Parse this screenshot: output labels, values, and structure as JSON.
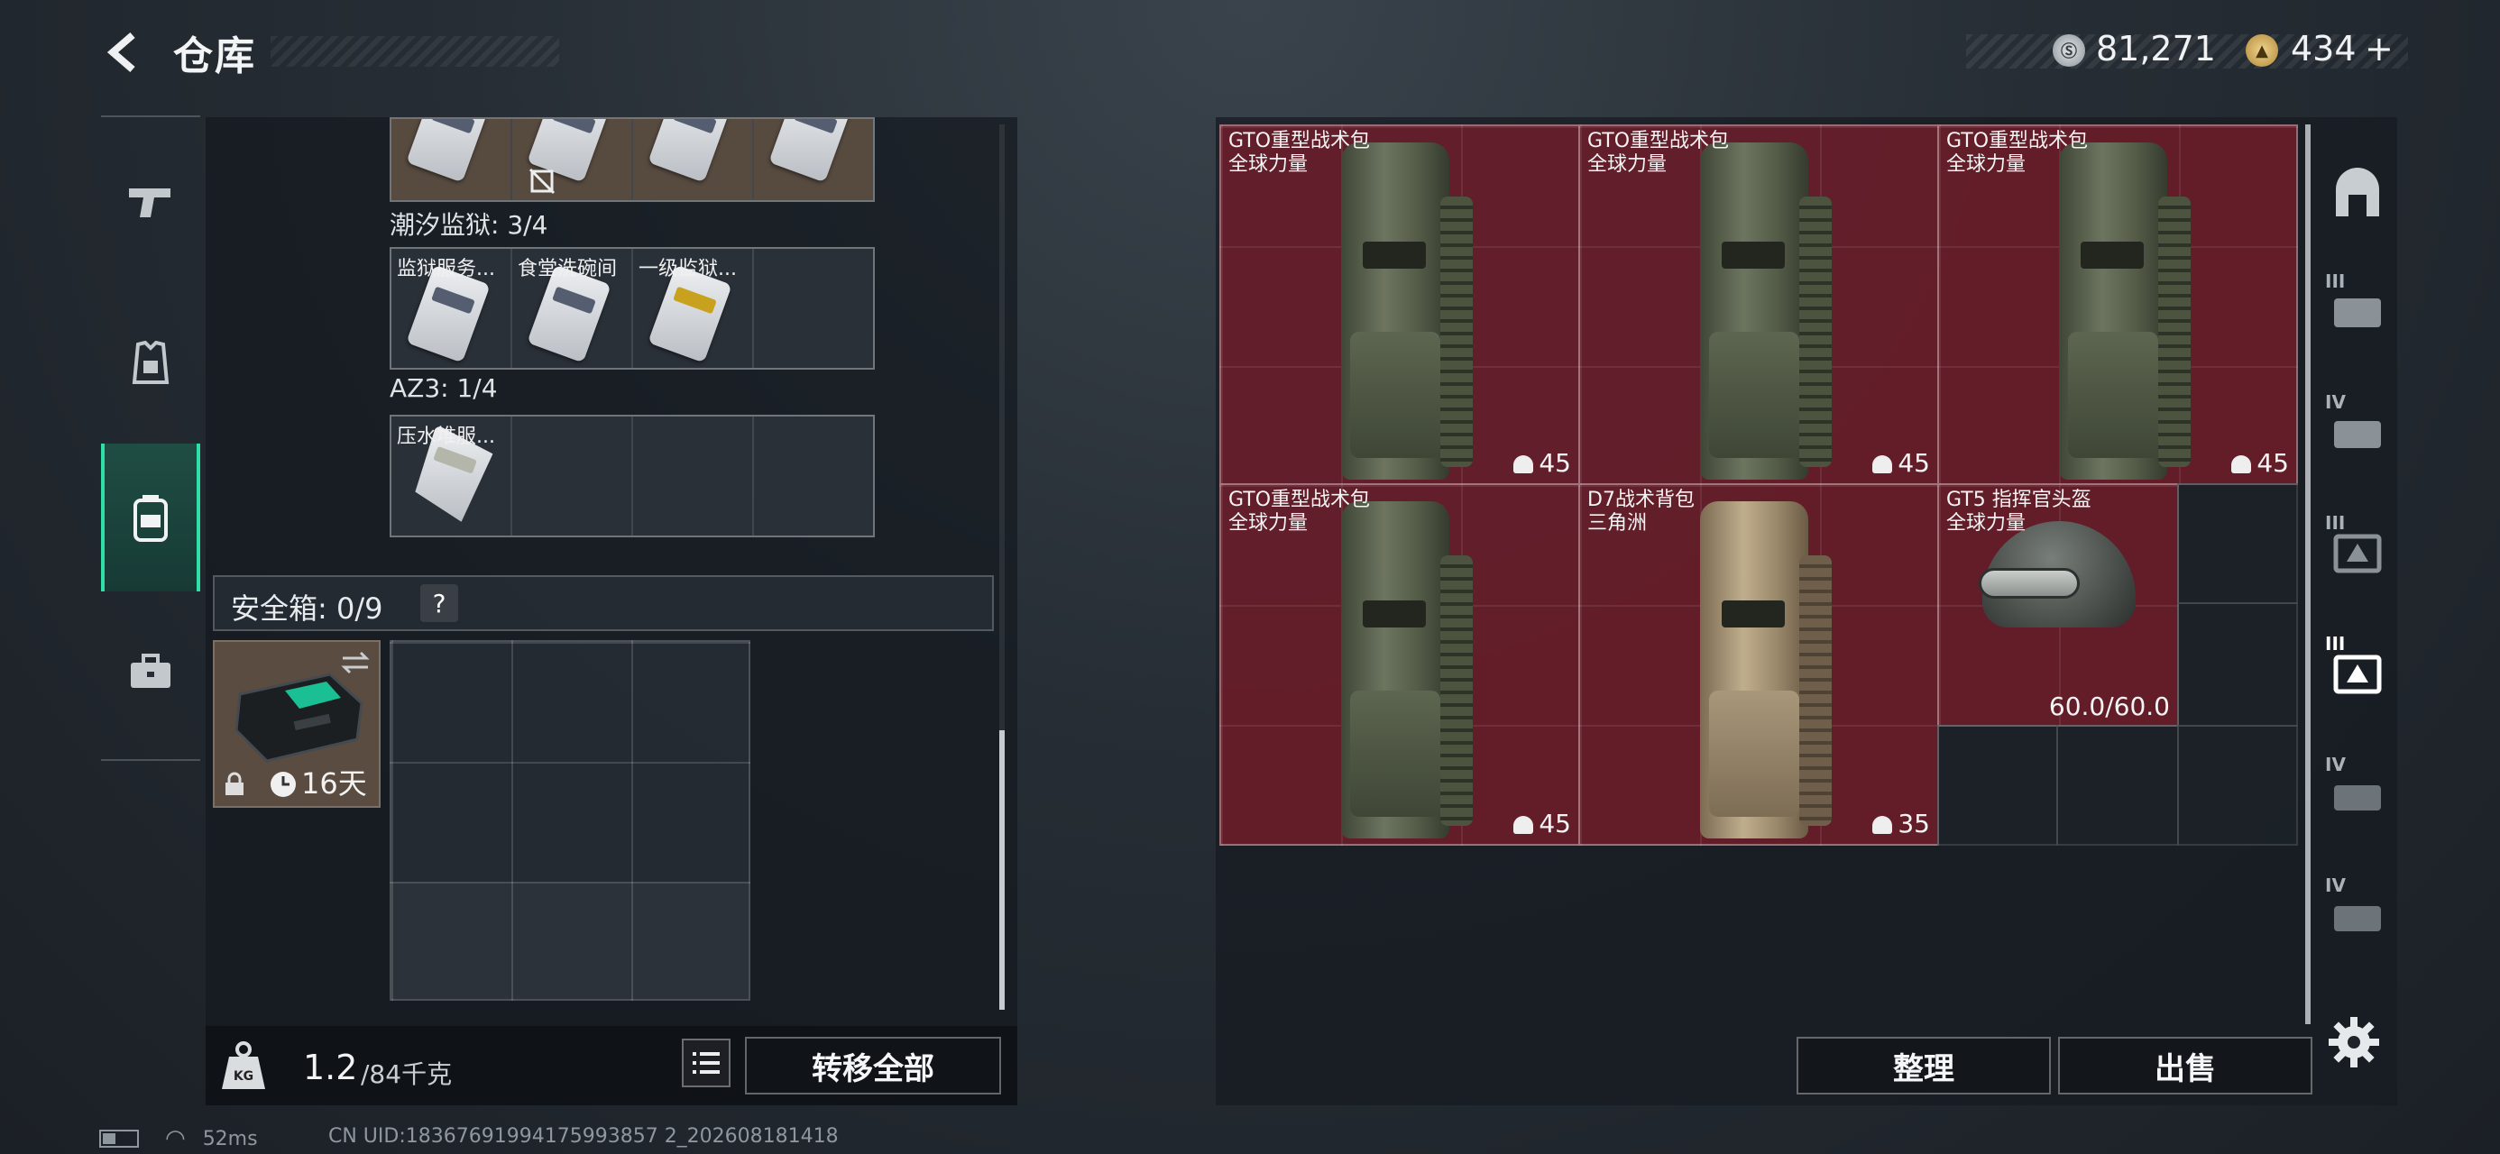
{
  "header": {
    "title": "仓库",
    "currency_silver": "81,271",
    "currency_gold": "434",
    "currency_add": "+"
  },
  "left_nav": [
    "weapon",
    "armor",
    "backpack",
    "briefcase"
  ],
  "inventory": {
    "top_row_count": 4,
    "section1": {
      "title": "潮汐监狱: 3/4",
      "items": [
        "监狱服务...",
        "食堂洗碗间",
        "一级监狱..."
      ]
    },
    "section2": {
      "title": "AZ3: 1/4",
      "items": [
        "压水堆服..."
      ]
    }
  },
  "safe_box": {
    "label": "安全箱: 0/9",
    "help": "?",
    "timer": "16天"
  },
  "weight": {
    "current": "1.2",
    "max": "/84千克",
    "kg_label": "KG"
  },
  "buttons": {
    "transfer_all": "转移全部",
    "sort": "整理",
    "sell": "出售"
  },
  "right_grid": [
    {
      "name": "GTO重型战术包",
      "sub": "全球力量",
      "count": "45"
    },
    {
      "name": "GTO重型战术包",
      "sub": "全球力量",
      "count": "45"
    },
    {
      "name": "GTO重型战术包",
      "sub": "全球力量",
      "count": "45"
    },
    {
      "name": "GTO重型战术包",
      "sub": "全球力量",
      "count": "45"
    },
    {
      "name": "D7战术背包",
      "sub": "三角洲",
      "count": "35"
    },
    {
      "name": "GT5 指挥官头盔",
      "sub": "全球力量",
      "durability": "60.0/60.0"
    }
  ],
  "right_nav_tiers": [
    "",
    "III",
    "IV",
    "III",
    "III",
    "IV",
    "IV"
  ],
  "status": {
    "ping": "52ms",
    "uid": "CN UID:18367691994175993857 2_202608181418"
  },
  "colors": {
    "accent": "#2fe0a6",
    "slot_red": "#6c1e2a"
  }
}
